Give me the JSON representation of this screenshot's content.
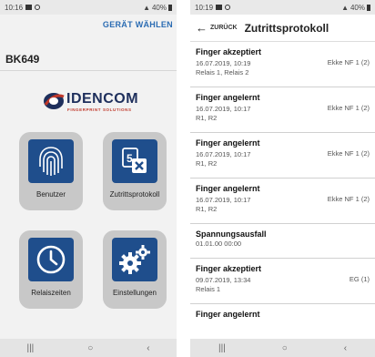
{
  "left": {
    "status": {
      "time": "10:16",
      "battery": "40%"
    },
    "action_label": "GERÄT WÄHLEN",
    "device_name": "BK649",
    "logo": {
      "word": "IDENCOM",
      "tagline": "FINGERPRINT SOLUTIONS"
    },
    "tiles": [
      {
        "label": "Benutzer",
        "icon": "fingerprint-icon"
      },
      {
        "label": "Zutrittsprotokoll",
        "icon": "log-icon"
      },
      {
        "label": "Relaiszeiten",
        "icon": "clock-icon"
      },
      {
        "label": "Einstellungen",
        "icon": "gears-icon"
      }
    ],
    "colors": {
      "accent": "#2b6cb3",
      "tile_icon": "#1f4e8c",
      "tile_bg": "#c8c8c8"
    }
  },
  "right": {
    "status": {
      "time": "10:19",
      "battery": "40%"
    },
    "back_label": "ZURÜCK",
    "title": "Zutrittsprotokoll",
    "entries": [
      {
        "event": "Finger akzeptiert",
        "time": "16.07.2019, 10:19",
        "relays": "Relais 1, Relais 2",
        "user": "Ekke NF 1 (2)"
      },
      {
        "event": "Finger angelernt",
        "time": "16.07.2019, 10:17",
        "relays": "R1, R2",
        "user": "Ekke NF 1 (2)"
      },
      {
        "event": "Finger angelernt",
        "time": "16.07.2019, 10:17",
        "relays": "R1, R2",
        "user": "Ekke NF 1 (2)"
      },
      {
        "event": "Finger angelernt",
        "time": "16.07.2019, 10:17",
        "relays": "R1, R2",
        "user": "Ekke NF 1 (2)"
      },
      {
        "event": "Spannungsausfall",
        "time": "01.01.00 00:00",
        "relays": "",
        "user": ""
      },
      {
        "event": "Finger akzeptiert",
        "time": "09.07.2019, 13:34",
        "relays": "Relais 1",
        "user": "EG (1)"
      },
      {
        "event": "Finger angelernt",
        "time": "",
        "relays": "",
        "user": ""
      }
    ]
  },
  "nav": {
    "recent": "|||",
    "home": "○",
    "back": "‹"
  }
}
